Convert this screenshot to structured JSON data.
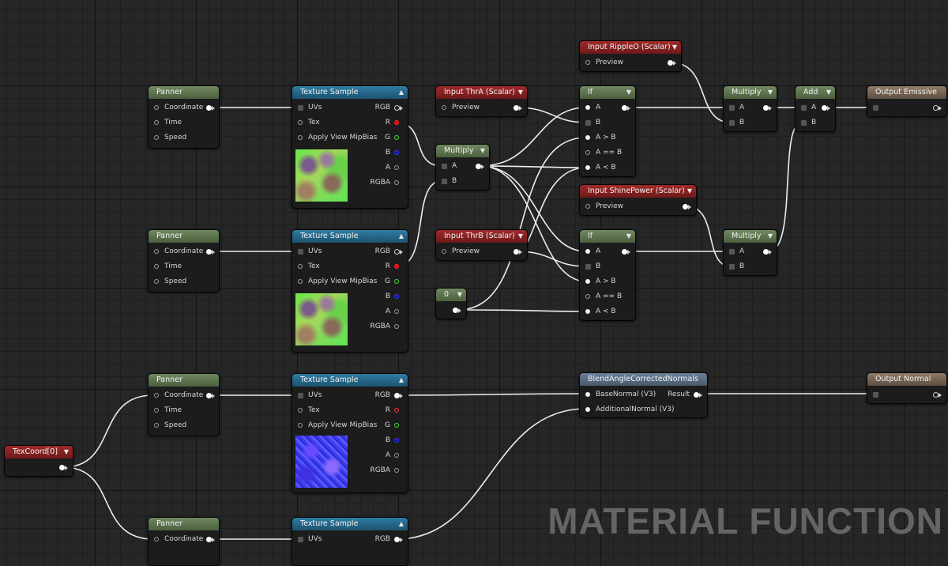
{
  "watermark": "MATERIAL FUNCTION",
  "colors": {
    "header_green": "#5f7650",
    "header_blue": "#266a8c",
    "header_red": "#8a2222",
    "header_steel": "#5b6f84",
    "header_tan": "#7a6958",
    "wire": "#ededed",
    "canvas_bg": "#262626"
  },
  "nodes": {
    "panner1": {
      "title": "Panner",
      "coordinate": "Coordinate",
      "time": "Time",
      "speed": "Speed"
    },
    "panner2": {
      "title": "Panner",
      "coordinate": "Coordinate",
      "time": "Time",
      "speed": "Speed"
    },
    "panner3": {
      "title": "Panner",
      "coordinate": "Coordinate",
      "time": "Time",
      "speed": "Speed"
    },
    "panner4": {
      "title": "Panner",
      "coordinate": "Coordinate"
    },
    "tex1": {
      "title": "Texture Sample",
      "uvs": "UVs",
      "tex": "Tex",
      "mip": "Apply View MipBias",
      "rgb": "RGB",
      "r": "R",
      "g": "G",
      "b": "B",
      "a": "A",
      "rgba": "RGBA"
    },
    "tex2": {
      "title": "Texture Sample",
      "uvs": "UVs",
      "tex": "Tex",
      "mip": "Apply View MipBias",
      "rgb": "RGB",
      "r": "R",
      "g": "G",
      "b": "B",
      "a": "A",
      "rgba": "RGBA"
    },
    "tex3": {
      "title": "Texture Sample",
      "uvs": "UVs",
      "tex": "Tex",
      "mip": "Apply View MipBias",
      "rgb": "RGB",
      "r": "R",
      "g": "G",
      "b": "B",
      "a": "A",
      "rgba": "RGBA"
    },
    "tex4": {
      "title": "Texture Sample",
      "uvs": "UVs",
      "rgb": "RGB"
    },
    "thrA": {
      "title": "Input ThrA (Scalar)",
      "preview": "Preview"
    },
    "thrB": {
      "title": "Input ThrB (Scalar)",
      "preview": "Preview"
    },
    "ripple": {
      "title": "Input RippleO (Scalar)",
      "preview": "Preview"
    },
    "shine": {
      "title": "Input ShinePower (Scalar)",
      "preview": "Preview"
    },
    "multiplyMid": {
      "title": "Multiply",
      "a": "A",
      "b": "B"
    },
    "zero": {
      "title": "0"
    },
    "if1": {
      "title": "If",
      "a": "A",
      "b": "B",
      "agtb": "A > B",
      "aeqb": "A == B",
      "altb": "A < B"
    },
    "if2": {
      "title": "If",
      "a": "A",
      "b": "B",
      "agtb": "A > B",
      "aeqb": "A == B",
      "altb": "A < B"
    },
    "multiplyTop": {
      "title": "Multiply",
      "a": "A",
      "b": "B"
    },
    "multiplyLow": {
      "title": "Multiply",
      "a": "A",
      "b": "B"
    },
    "add": {
      "title": "Add",
      "a": "A",
      "b": "B"
    },
    "outEmissive": {
      "title": "Output Emissive"
    },
    "blend": {
      "title": "BlendAngleCorrectedNormals",
      "base": "BaseNormal (V3)",
      "additional": "AdditionalNormal (V3)",
      "result": "Result"
    },
    "outNormal": {
      "title": "Output Normal"
    },
    "texcoord": {
      "title": "TexCoord[0]"
    }
  }
}
